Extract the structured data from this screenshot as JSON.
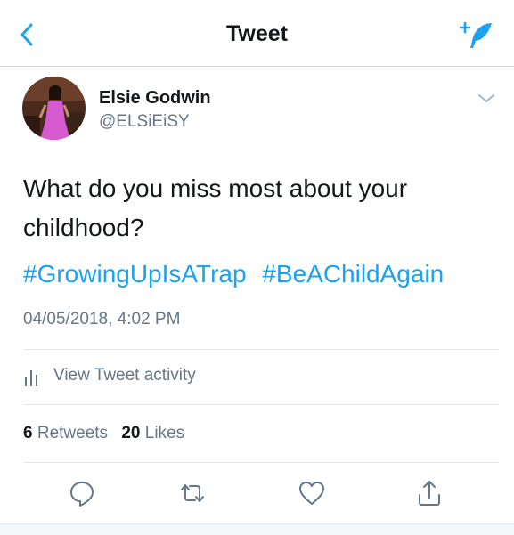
{
  "nav": {
    "title": "Tweet",
    "back_icon": "chevron-left-icon",
    "compose_icon": "compose-tweet-icon"
  },
  "author": {
    "name": "Elsie Godwin",
    "handle": "@ELSiEiSY",
    "menu_icon": "chevron-down-icon"
  },
  "tweet": {
    "text": "What do you miss most about your childhood?",
    "hashtags": [
      "#GrowingUpIsATrap",
      "#BeAChildAgain"
    ],
    "timestamp": "04/05/2018, 4:02 PM"
  },
  "activity": {
    "label": "View Tweet activity",
    "icon": "bar-chart-icon"
  },
  "stats": {
    "retweets_count": "6",
    "retweets_label": "Retweets",
    "likes_count": "20",
    "likes_label": "Likes"
  },
  "actions": [
    "reply-icon",
    "retweet-icon",
    "like-icon",
    "share-icon"
  ],
  "colors": {
    "accent": "#1da1f2",
    "text": "#14171a",
    "muted": "#657786",
    "divider": "#e1e8ed"
  }
}
